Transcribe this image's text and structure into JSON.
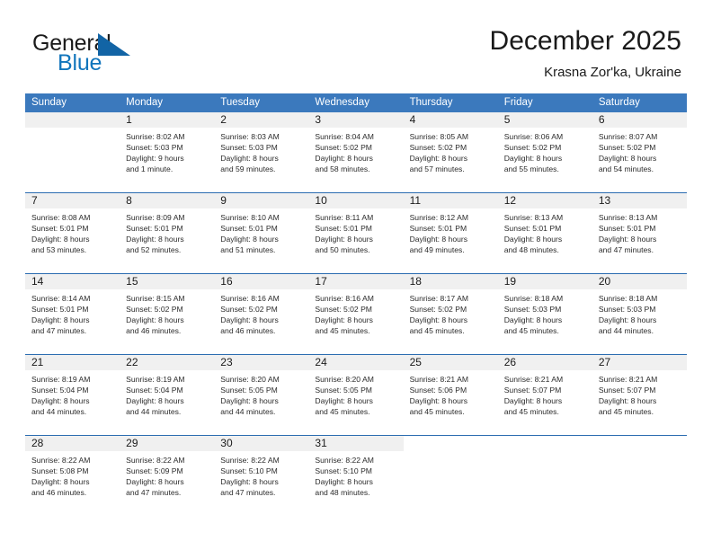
{
  "brand": {
    "name_part1": "General",
    "name_part2": "Blue",
    "triangle_icon": "triangle-icon",
    "accent_color": "#1175bc",
    "triangle_color": "#1264a5"
  },
  "header": {
    "month_title": "December 2025",
    "location": "Krasna Zor'ka, Ukraine"
  },
  "calendar": {
    "header_bg": "#3b79bd",
    "daynum_bg": "#f0f0f0",
    "row_divider": "#2b6cb0",
    "weekdays": [
      "Sunday",
      "Monday",
      "Tuesday",
      "Wednesday",
      "Thursday",
      "Friday",
      "Saturday"
    ],
    "labels": {
      "sunrise": "Sunrise:",
      "sunset": "Sunset:",
      "daylight": "Daylight:"
    },
    "weeks": [
      [
        {
          "day": "",
          "empty": true
        },
        {
          "day": "1",
          "sunrise": "Sunrise: 8:02 AM",
          "sunset": "Sunset: 5:03 PM",
          "daylight_l1": "Daylight: 9 hours",
          "daylight_l2": "and 1 minute."
        },
        {
          "day": "2",
          "sunrise": "Sunrise: 8:03 AM",
          "sunset": "Sunset: 5:03 PM",
          "daylight_l1": "Daylight: 8 hours",
          "daylight_l2": "and 59 minutes."
        },
        {
          "day": "3",
          "sunrise": "Sunrise: 8:04 AM",
          "sunset": "Sunset: 5:02 PM",
          "daylight_l1": "Daylight: 8 hours",
          "daylight_l2": "and 58 minutes."
        },
        {
          "day": "4",
          "sunrise": "Sunrise: 8:05 AM",
          "sunset": "Sunset: 5:02 PM",
          "daylight_l1": "Daylight: 8 hours",
          "daylight_l2": "and 57 minutes."
        },
        {
          "day": "5",
          "sunrise": "Sunrise: 8:06 AM",
          "sunset": "Sunset: 5:02 PM",
          "daylight_l1": "Daylight: 8 hours",
          "daylight_l2": "and 55 minutes."
        },
        {
          "day": "6",
          "sunrise": "Sunrise: 8:07 AM",
          "sunset": "Sunset: 5:02 PM",
          "daylight_l1": "Daylight: 8 hours",
          "daylight_l2": "and 54 minutes."
        }
      ],
      [
        {
          "day": "7",
          "sunrise": "Sunrise: 8:08 AM",
          "sunset": "Sunset: 5:01 PM",
          "daylight_l1": "Daylight: 8 hours",
          "daylight_l2": "and 53 minutes."
        },
        {
          "day": "8",
          "sunrise": "Sunrise: 8:09 AM",
          "sunset": "Sunset: 5:01 PM",
          "daylight_l1": "Daylight: 8 hours",
          "daylight_l2": "and 52 minutes."
        },
        {
          "day": "9",
          "sunrise": "Sunrise: 8:10 AM",
          "sunset": "Sunset: 5:01 PM",
          "daylight_l1": "Daylight: 8 hours",
          "daylight_l2": "and 51 minutes."
        },
        {
          "day": "10",
          "sunrise": "Sunrise: 8:11 AM",
          "sunset": "Sunset: 5:01 PM",
          "daylight_l1": "Daylight: 8 hours",
          "daylight_l2": "and 50 minutes."
        },
        {
          "day": "11",
          "sunrise": "Sunrise: 8:12 AM",
          "sunset": "Sunset: 5:01 PM",
          "daylight_l1": "Daylight: 8 hours",
          "daylight_l2": "and 49 minutes."
        },
        {
          "day": "12",
          "sunrise": "Sunrise: 8:13 AM",
          "sunset": "Sunset: 5:01 PM",
          "daylight_l1": "Daylight: 8 hours",
          "daylight_l2": "and 48 minutes."
        },
        {
          "day": "13",
          "sunrise": "Sunrise: 8:13 AM",
          "sunset": "Sunset: 5:01 PM",
          "daylight_l1": "Daylight: 8 hours",
          "daylight_l2": "and 47 minutes."
        }
      ],
      [
        {
          "day": "14",
          "sunrise": "Sunrise: 8:14 AM",
          "sunset": "Sunset: 5:01 PM",
          "daylight_l1": "Daylight: 8 hours",
          "daylight_l2": "and 47 minutes."
        },
        {
          "day": "15",
          "sunrise": "Sunrise: 8:15 AM",
          "sunset": "Sunset: 5:02 PM",
          "daylight_l1": "Daylight: 8 hours",
          "daylight_l2": "and 46 minutes."
        },
        {
          "day": "16",
          "sunrise": "Sunrise: 8:16 AM",
          "sunset": "Sunset: 5:02 PM",
          "daylight_l1": "Daylight: 8 hours",
          "daylight_l2": "and 46 minutes."
        },
        {
          "day": "17",
          "sunrise": "Sunrise: 8:16 AM",
          "sunset": "Sunset: 5:02 PM",
          "daylight_l1": "Daylight: 8 hours",
          "daylight_l2": "and 45 minutes."
        },
        {
          "day": "18",
          "sunrise": "Sunrise: 8:17 AM",
          "sunset": "Sunset: 5:02 PM",
          "daylight_l1": "Daylight: 8 hours",
          "daylight_l2": "and 45 minutes."
        },
        {
          "day": "19",
          "sunrise": "Sunrise: 8:18 AM",
          "sunset": "Sunset: 5:03 PM",
          "daylight_l1": "Daylight: 8 hours",
          "daylight_l2": "and 45 minutes."
        },
        {
          "day": "20",
          "sunrise": "Sunrise: 8:18 AM",
          "sunset": "Sunset: 5:03 PM",
          "daylight_l1": "Daylight: 8 hours",
          "daylight_l2": "and 44 minutes."
        }
      ],
      [
        {
          "day": "21",
          "sunrise": "Sunrise: 8:19 AM",
          "sunset": "Sunset: 5:04 PM",
          "daylight_l1": "Daylight: 8 hours",
          "daylight_l2": "and 44 minutes."
        },
        {
          "day": "22",
          "sunrise": "Sunrise: 8:19 AM",
          "sunset": "Sunset: 5:04 PM",
          "daylight_l1": "Daylight: 8 hours",
          "daylight_l2": "and 44 minutes."
        },
        {
          "day": "23",
          "sunrise": "Sunrise: 8:20 AM",
          "sunset": "Sunset: 5:05 PM",
          "daylight_l1": "Daylight: 8 hours",
          "daylight_l2": "and 44 minutes."
        },
        {
          "day": "24",
          "sunrise": "Sunrise: 8:20 AM",
          "sunset": "Sunset: 5:05 PM",
          "daylight_l1": "Daylight: 8 hours",
          "daylight_l2": "and 45 minutes."
        },
        {
          "day": "25",
          "sunrise": "Sunrise: 8:21 AM",
          "sunset": "Sunset: 5:06 PM",
          "daylight_l1": "Daylight: 8 hours",
          "daylight_l2": "and 45 minutes."
        },
        {
          "day": "26",
          "sunrise": "Sunrise: 8:21 AM",
          "sunset": "Sunset: 5:07 PM",
          "daylight_l1": "Daylight: 8 hours",
          "daylight_l2": "and 45 minutes."
        },
        {
          "day": "27",
          "sunrise": "Sunrise: 8:21 AM",
          "sunset": "Sunset: 5:07 PM",
          "daylight_l1": "Daylight: 8 hours",
          "daylight_l2": "and 45 minutes."
        }
      ],
      [
        {
          "day": "28",
          "sunrise": "Sunrise: 8:22 AM",
          "sunset": "Sunset: 5:08 PM",
          "daylight_l1": "Daylight: 8 hours",
          "daylight_l2": "and 46 minutes."
        },
        {
          "day": "29",
          "sunrise": "Sunrise: 8:22 AM",
          "sunset": "Sunset: 5:09 PM",
          "daylight_l1": "Daylight: 8 hours",
          "daylight_l2": "and 47 minutes."
        },
        {
          "day": "30",
          "sunrise": "Sunrise: 8:22 AM",
          "sunset": "Sunset: 5:10 PM",
          "daylight_l1": "Daylight: 8 hours",
          "daylight_l2": "and 47 minutes."
        },
        {
          "day": "31",
          "sunrise": "Sunrise: 8:22 AM",
          "sunset": "Sunset: 5:10 PM",
          "daylight_l1": "Daylight: 8 hours",
          "daylight_l2": "and 48 minutes."
        },
        {
          "day": "",
          "empty": true,
          "blank": true
        },
        {
          "day": "",
          "empty": true,
          "blank": true
        },
        {
          "day": "",
          "empty": true,
          "blank": true
        }
      ]
    ]
  }
}
